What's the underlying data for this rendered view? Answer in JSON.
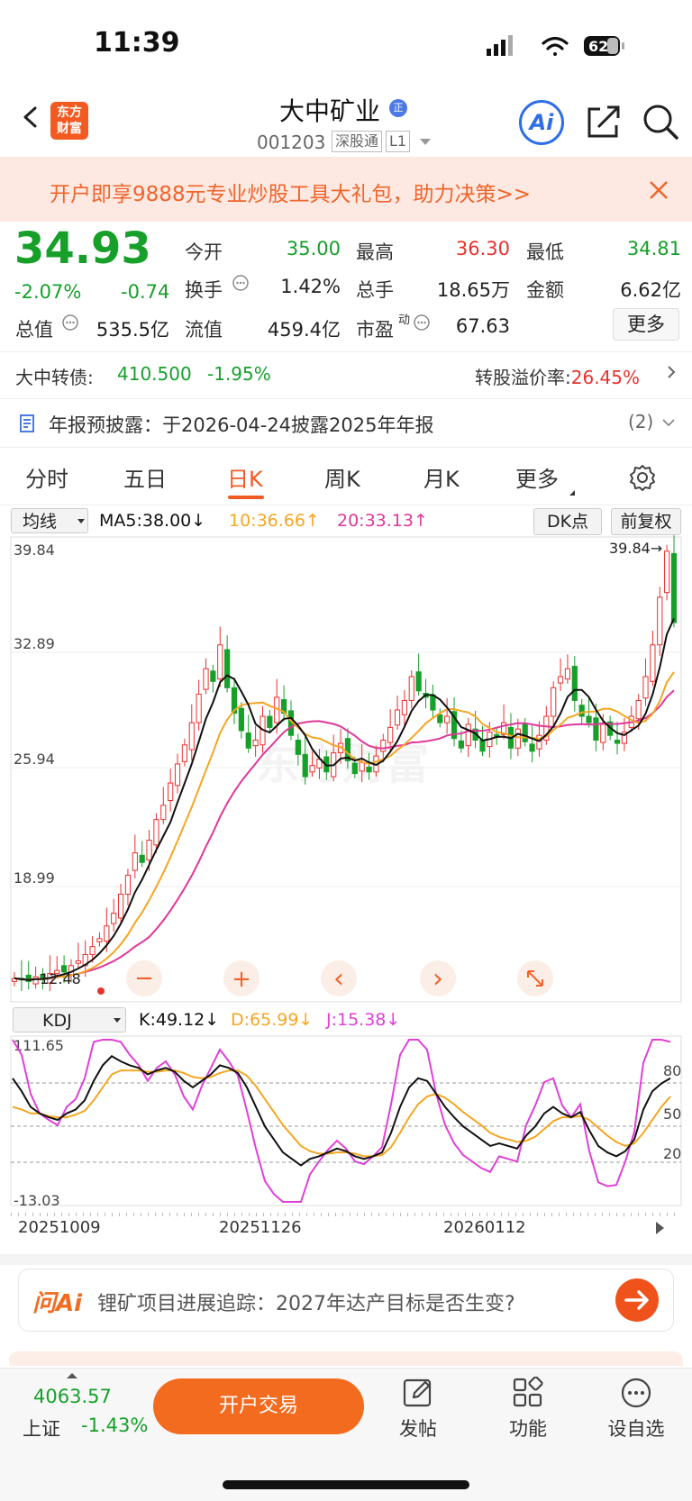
{
  "status": {
    "time": "11:39",
    "battery": "62"
  },
  "header": {
    "logo_line1": "东方",
    "logo_line2": "财富",
    "name": "大中矿业",
    "name_badge": "正",
    "code": "001203",
    "tag_connect": "深股通",
    "tag_level": "L1",
    "ai_label": "Ai"
  },
  "banner": {
    "text": "开户即享9888元专业炒股工具大礼包，助力决策>>"
  },
  "quote": {
    "price": "34.93",
    "pct": "-2.07%",
    "change": "-0.74",
    "rows": [
      [
        {
          "label": "今开",
          "value": "35.00",
          "color": "green"
        },
        {
          "label": "最高",
          "value": "36.30",
          "color": "red"
        },
        {
          "label": "最低",
          "value": "34.81",
          "color": "green"
        }
      ],
      [
        {
          "label": "换手",
          "value": "1.42%",
          "color": "plain"
        },
        {
          "label": "总手",
          "value": "18.65万",
          "color": "plain"
        },
        {
          "label": "金额",
          "value": "6.62亿",
          "color": "plain"
        }
      ]
    ],
    "cap_label": "总值",
    "cap_value": "535.5亿",
    "float_label": "流值",
    "float_value": "459.4亿",
    "pe_label": "市盈",
    "pe_sup": "动",
    "pe_value": "67.63",
    "more": "更多"
  },
  "bond": {
    "label": "大中转债:",
    "value": "410.500",
    "pct": "-1.95%",
    "premium_label": "转股溢价率:",
    "premium_value": "26.45%"
  },
  "announcement": {
    "text": "年报预披露：于2026-04-24披露2025年年报",
    "count": "(2)"
  },
  "tabs": [
    "分时",
    "五日",
    "日K",
    "周K",
    "月K",
    "更多"
  ],
  "active_tab": "日K",
  "chart_toolbar": {
    "indicator": "均线",
    "ma5": "MA5:38.00↓",
    "ma10": "10:36.66↑",
    "ma20": "20:33.13↑",
    "dk": "DK点",
    "adjust": "前复权",
    "ma5_color": "#111111",
    "ma10_color": "#f5a623",
    "ma20_color": "#e0379a"
  },
  "chart_data": [
    {
      "type": "candlestick",
      "y_ticks": [
        "39.84",
        "32.89",
        "25.94",
        "18.99"
      ],
      "ylim": [
        12.04,
        39.84
      ],
      "max_label": "39.84→",
      "min_label": "12.48",
      "watermark": "东方财富",
      "close_series": [
        12.5,
        12.4,
        12.3,
        12.6,
        12.5,
        12.8,
        13.0,
        12.9,
        13.3,
        13.6,
        14.0,
        14.5,
        15.0,
        15.8,
        16.6,
        17.8,
        19.0,
        20.4,
        19.8,
        21.2,
        22.5,
        23.4,
        24.8,
        26.0,
        27.2,
        28.6,
        30.4,
        32.0,
        31.2,
        33.5,
        30.8,
        29.2,
        28.1,
        27.0,
        27.5,
        29.0,
        28.3,
        30.2,
        29.2,
        27.8,
        26.6,
        25.2,
        25.9,
        26.3,
        25.5,
        26.7,
        27.3,
        26.2,
        25.4,
        26.1,
        25.5,
        26.5,
        27.5,
        28.3,
        29.4,
        30.0,
        31.5,
        30.6,
        30.2,
        29.4,
        28.6,
        29.0,
        27.6,
        27.0,
        28.5,
        27.5,
        26.8,
        28.0,
        27.7,
        28.6,
        27.0,
        28.2,
        27.4,
        26.8,
        27.8,
        29.0,
        30.8,
        31.5,
        32.0,
        30.0,
        29.0,
        28.6,
        27.5,
        28.5,
        27.8,
        27.3,
        28.0,
        29.0,
        30.0,
        31.5,
        33.5,
        36.5,
        39.4,
        34.9
      ]
    },
    {
      "type": "line",
      "indicator": "KDJ",
      "k_label": "K:49.12↓",
      "d_label": "D:65.99↓",
      "j_label": "J:15.38↓",
      "y_ticks": [
        "111.65",
        "-13.03"
      ],
      "ref_ticks": [
        "80",
        "50",
        "20"
      ],
      "x_ticks": [
        "20251009",
        "20251126",
        "20260112"
      ],
      "series": [
        {
          "key": "K",
          "color": "#111111"
        },
        {
          "key": "D",
          "color": "#f5a623"
        },
        {
          "key": "J",
          "color": "#e040d8"
        }
      ],
      "k_values": [
        82,
        72,
        60,
        55,
        52,
        50,
        55,
        58,
        65,
        80,
        92,
        99,
        95,
        92,
        90,
        85,
        88,
        90,
        87,
        80,
        75,
        80,
        85,
        92,
        90,
        86,
        75,
        60,
        45,
        35,
        25,
        20,
        15,
        20,
        22,
        25,
        28,
        26,
        22,
        20,
        22,
        25,
        40,
        60,
        75,
        82,
        80,
        70,
        60,
        52,
        45,
        40,
        35,
        30,
        32,
        30,
        28,
        38,
        45,
        55,
        60,
        55,
        52,
        56,
        42,
        30,
        25,
        22,
        26,
        35,
        58,
        72,
        78,
        82
      ],
      "d_values": [
        60,
        58,
        55,
        55,
        53,
        52,
        52,
        54,
        57,
        65,
        75,
        85,
        88,
        88,
        88,
        87,
        87,
        88,
        88,
        86,
        83,
        82,
        83,
        86,
        88,
        88,
        84,
        76,
        66,
        56,
        46,
        38,
        30,
        26,
        24,
        24,
        25,
        25,
        24,
        22,
        22,
        23,
        29,
        40,
        52,
        62,
        68,
        70,
        67,
        62,
        56,
        51,
        46,
        40,
        37,
        35,
        33,
        34,
        37,
        43,
        49,
        52,
        52,
        53,
        50,
        44,
        38,
        33,
        30,
        32,
        40,
        50,
        60,
        68
      ],
      "j_values": [
        125,
        100,
        70,
        55,
        50,
        46,
        60,
        66,
        82,
        110,
        125,
        128,
        110,
        100,
        92,
        80,
        90,
        95,
        85,
        68,
        58,
        76,
        90,
        104,
        95,
        84,
        57,
        28,
        3,
        -7,
        -17,
        -16,
        -15,
        8,
        18,
        27,
        34,
        28,
        18,
        16,
        22,
        29,
        62,
        100,
        121,
        122,
        104,
        70,
        46,
        32,
        23,
        18,
        13,
        10,
        22,
        20,
        18,
        46,
        61,
        79,
        82,
        61,
        52,
        62,
        26,
        2,
        -1,
        0,
        18,
        41,
        94,
        116,
        114,
        110
      ]
    }
  ],
  "chart_nav": {
    "minus": "−",
    "plus": "+",
    "left": "‹",
    "right": "›"
  },
  "ask": {
    "brand": "问Ai",
    "text": "锂矿项目进展追踪：2027年达产目标是否生变?"
  },
  "bottom": {
    "index_value": "4063.57",
    "index_name": "上证",
    "index_pct": "-1.43%",
    "open_btn": "开户交易",
    "post": "发帖",
    "func": "功能",
    "watch": "设自选"
  }
}
